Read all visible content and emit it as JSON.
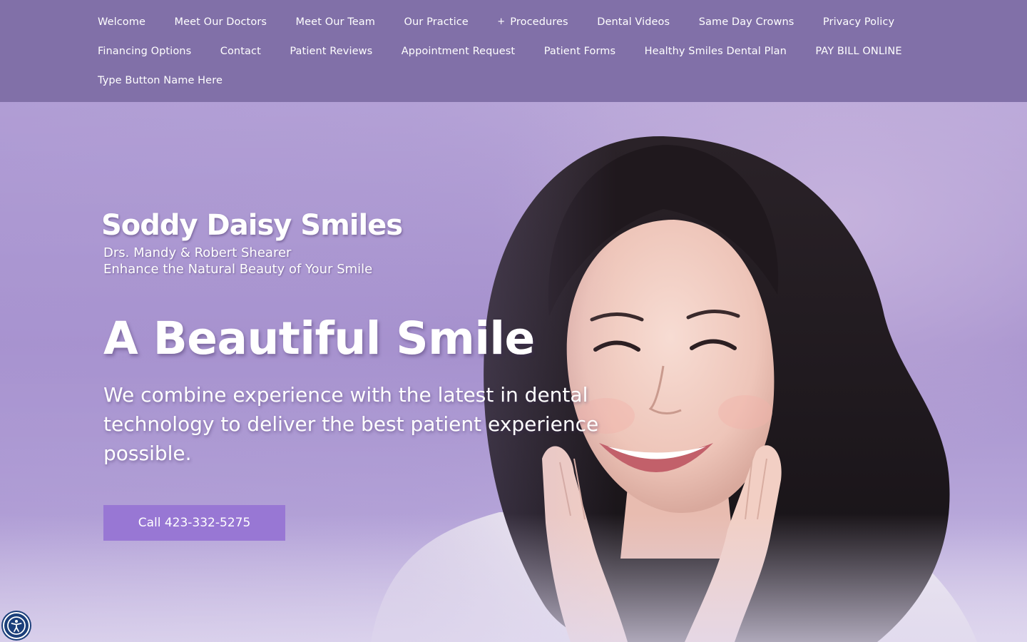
{
  "nav": {
    "row1": [
      "Welcome",
      "Meet Our Doctors",
      "Meet Our Team",
      "Our Practice",
      "Procedures",
      "Dental Videos",
      "Same Day Crowns",
      "Privacy Policy"
    ],
    "row2": [
      "Financing Options",
      "Contact",
      "Patient Reviews",
      "Appointment Request",
      "Patient Forms",
      "Healthy Smiles Dental Plan",
      "PAY BILL ONLINE"
    ],
    "row3": [
      "Type Button Name Here"
    ],
    "procedures_prefix_icon": "plus-icon"
  },
  "hero": {
    "brand": "Soddy Daisy Smiles",
    "doctors": "Drs. Mandy & Robert Shearer",
    "slogan": "Enhance the Natural Beauty of Your Smile",
    "headline": "A Beautiful Smile",
    "tagline": "We combine experience with the latest in dental technology to deliver the best patient experience possible.",
    "cta_label": "Call 423-332-5275"
  },
  "accessibility": {
    "icon": "accessibility-icon"
  },
  "colors": {
    "nav_background": "#8170a8",
    "cta_background": "#9877d4",
    "hero_background": "#b8a6d8",
    "accessibility_button": "#1b3f7a"
  }
}
